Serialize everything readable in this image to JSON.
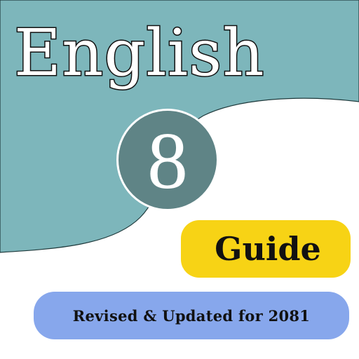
{
  "title": "English",
  "grade": "8",
  "badge": "Guide",
  "subtitle": "Revised & Updated for 2081",
  "colors": {
    "teal_background": "#7db6bb",
    "circle": "#5f8486",
    "guide_pill": "#f7d315",
    "subtitle_pill": "#87a7ec",
    "text_dark": "#111111"
  }
}
